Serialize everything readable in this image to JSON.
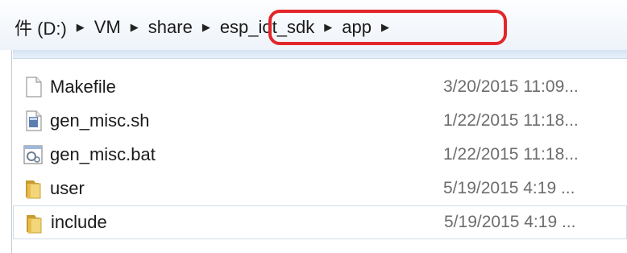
{
  "address_bar": {
    "crumbs": [
      "件 (D:)",
      "VM",
      "share",
      "esp_iot_sdk",
      "app"
    ],
    "separator_icon": "triangle-right",
    "highlight_color": "#e3262a"
  },
  "files": [
    {
      "name": "Makefile",
      "date": "3/20/2015 11:09...",
      "icon": "document-icon"
    },
    {
      "name": "gen_misc.sh",
      "date": "1/22/2015 11:18...",
      "icon": "script-file-icon"
    },
    {
      "name": "gen_misc.bat",
      "date": "1/22/2015 11:18...",
      "icon": "batch-file-icon"
    },
    {
      "name": "user",
      "date": "5/19/2015 4:19 ...",
      "icon": "folder-icon"
    },
    {
      "name": "include",
      "date": "5/19/2015 4:19 ...",
      "icon": "folder-icon"
    }
  ]
}
